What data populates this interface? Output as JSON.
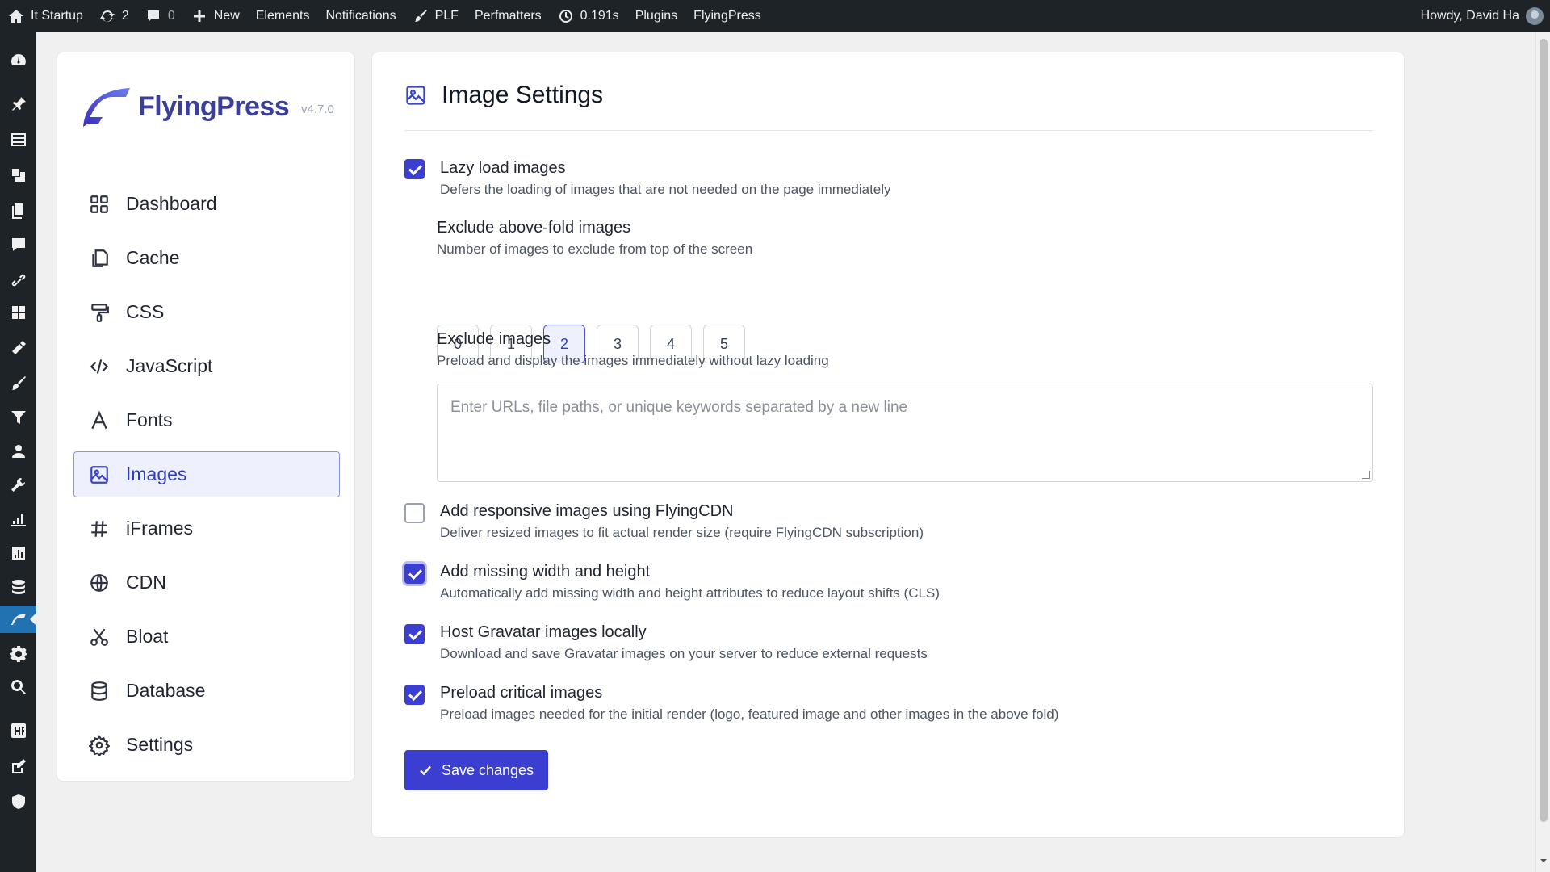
{
  "adminbar": {
    "site_name": "It Startup",
    "updates_count": "2",
    "comments_count": "0",
    "new_label": "New",
    "elements_label": "Elements",
    "notifications_label": "Notifications",
    "plf_label": "PLF",
    "perfmatters_label": "Perfmatters",
    "timing_label": "0.191s",
    "plugins_label": "Plugins",
    "flyingpress_label": "FlyingPress",
    "howdy_label": "Howdy, David Ha"
  },
  "sidebar": {
    "brand": "FlyingPress",
    "version": "v4.7.0",
    "items": [
      {
        "label": "Dashboard",
        "icon": "grid-icon"
      },
      {
        "label": "Cache",
        "icon": "copy-icon"
      },
      {
        "label": "CSS",
        "icon": "paint-roller-icon"
      },
      {
        "label": "JavaScript",
        "icon": "code-icon"
      },
      {
        "label": "Fonts",
        "icon": "font-icon"
      },
      {
        "label": "Images",
        "icon": "image-icon",
        "active": true
      },
      {
        "label": "iFrames",
        "icon": "hash-icon"
      },
      {
        "label": "CDN",
        "icon": "globe-icon"
      },
      {
        "label": "Bloat",
        "icon": "scissors-icon"
      },
      {
        "label": "Database",
        "icon": "database-icon"
      },
      {
        "label": "Settings",
        "icon": "gear-icon"
      }
    ]
  },
  "main": {
    "title": "Image Settings",
    "lazy_load": {
      "title": "Lazy load images",
      "desc": "Defers the loading of images that are not needed on the page immediately",
      "checked": true
    },
    "exclude_above_fold": {
      "title": "Exclude above-fold images",
      "desc": "Number of images to exclude from top of the screen",
      "options": [
        "0",
        "1",
        "2",
        "3",
        "4",
        "5"
      ],
      "selected": "2"
    },
    "exclude_images": {
      "title": "Exclude images",
      "desc": "Preload and display the images immediately without lazy loading",
      "placeholder": "Enter URLs, file paths, or unique keywords separated by a new line",
      "value": ""
    },
    "responsive": {
      "title": "Add responsive images using FlyingCDN",
      "desc": "Deliver resized images to fit actual render size (require FlyingCDN subscription)",
      "checked": false
    },
    "width_height": {
      "title": "Add missing width and height",
      "desc": "Automatically add missing width and height attributes to reduce layout shifts (CLS)",
      "checked": true
    },
    "gravatar": {
      "title": "Host Gravatar images locally",
      "desc": "Download and save Gravatar images on your server to reduce external requests",
      "checked": true
    },
    "preload": {
      "title": "Preload critical images",
      "desc": "Preload images needed for the initial render (logo, featured image and other images in the above fold)",
      "checked": true
    },
    "save_label": "Save changes"
  },
  "colors": {
    "accent": "#3b3fd1",
    "admin_bar": "#1d2327",
    "active_menu": "#2271b1"
  }
}
